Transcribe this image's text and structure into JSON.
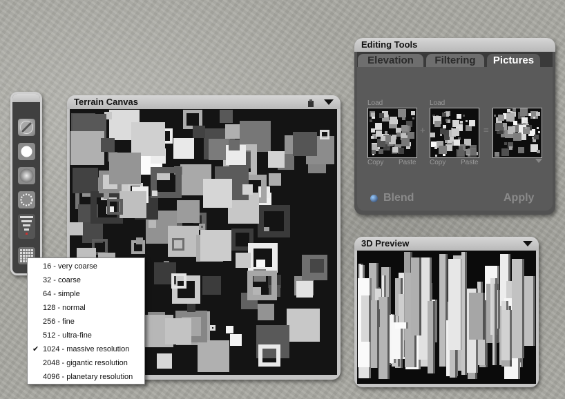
{
  "terrain_canvas": {
    "title": "Terrain Canvas"
  },
  "resolution_menu": {
    "items": [
      "16 - very coarse",
      "32 - coarse",
      "64 - simple",
      "128 - normal",
      "256 - fine",
      "512 - ultra-fine",
      "1024 - massive resolution",
      "2048 - gigantic resolution",
      "4096 - planetary resolution"
    ],
    "selected": "1024 - massive resolution",
    "check_mark": "✔"
  },
  "editing_tools": {
    "title": "Editing Tools",
    "tabs": [
      "Elevation",
      "Filtering",
      "Pictures"
    ],
    "active_tab": "Pictures",
    "slots": {
      "slot1": {
        "load": "Load",
        "copy": "Copy",
        "paste": "Paste"
      },
      "slot2": {
        "load": "Load",
        "copy": "Copy",
        "paste": "Paste"
      }
    },
    "operator_plus": "+",
    "operator_equals": "=",
    "blend_label": "Blend",
    "apply_label": "Apply"
  },
  "preview_3d": {
    "title": "3D Preview"
  },
  "toolbar": {
    "tools": [
      "brush-icon",
      "circle-icon",
      "soft-circle-icon",
      "dotted-circle-icon",
      "falloff-icon",
      "grid-icon"
    ]
  }
}
